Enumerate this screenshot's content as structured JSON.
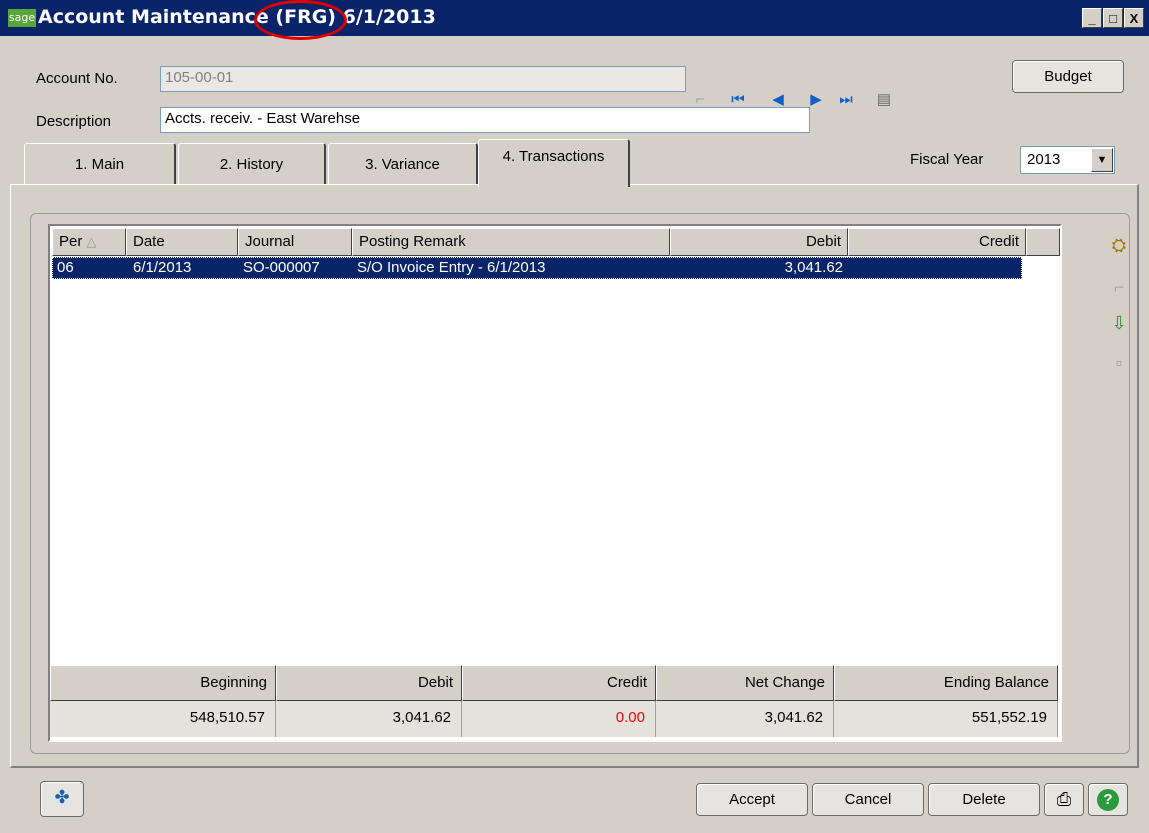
{
  "window": {
    "logo": "sage",
    "title": "Account Maintenance (FRG) 6/1/2013",
    "minimize": "_",
    "maximize": "□",
    "close": "X"
  },
  "form": {
    "account_no_label": "Account No.",
    "account_no_value": "105-00-01",
    "description_label": "Description",
    "description_value": "Accts. receiv. - East Warehse",
    "budget_button": "Budget",
    "fiscal_year_label": "Fiscal Year",
    "fiscal_year_value": "2013"
  },
  "tabs": [
    {
      "label": "1. Main"
    },
    {
      "label": "2. History"
    },
    {
      "label": "3. Variance"
    },
    {
      "label": "4. Transactions",
      "active": true
    }
  ],
  "grid": {
    "columns": [
      "Per",
      "Date",
      "Journal",
      "Posting Remark",
      "Debit",
      "Credit"
    ],
    "rows": [
      {
        "per": "06",
        "date": "6/1/2013",
        "journal": "SO-000007",
        "remark": "S/O Invoice Entry - 6/1/2013",
        "debit": "3,041.62",
        "credit": ""
      }
    ]
  },
  "totals": {
    "headers": [
      "Beginning",
      "Debit",
      "Credit",
      "Net Change",
      "Ending Balance"
    ],
    "values": [
      "548,510.57",
      "3,041.62",
      "0.00",
      "3,041.62",
      "551,552.19"
    ]
  },
  "footer": {
    "accept": "Accept",
    "cancel": "Cancel",
    "delete": "Delete"
  },
  "icons": {
    "sort_indicator": "△",
    "grid_actions": [
      "binoculars-icon",
      "blank-icon",
      "export-icon",
      "blank-icon"
    ],
    "footer": [
      "windows-icon",
      "printer-icon",
      "help-icon"
    ]
  },
  "colors": {
    "titlebar": "#0a246a",
    "credit_total": "#ff0000",
    "selected_row": "#0a246a",
    "annotation_circle": "#e00000"
  }
}
